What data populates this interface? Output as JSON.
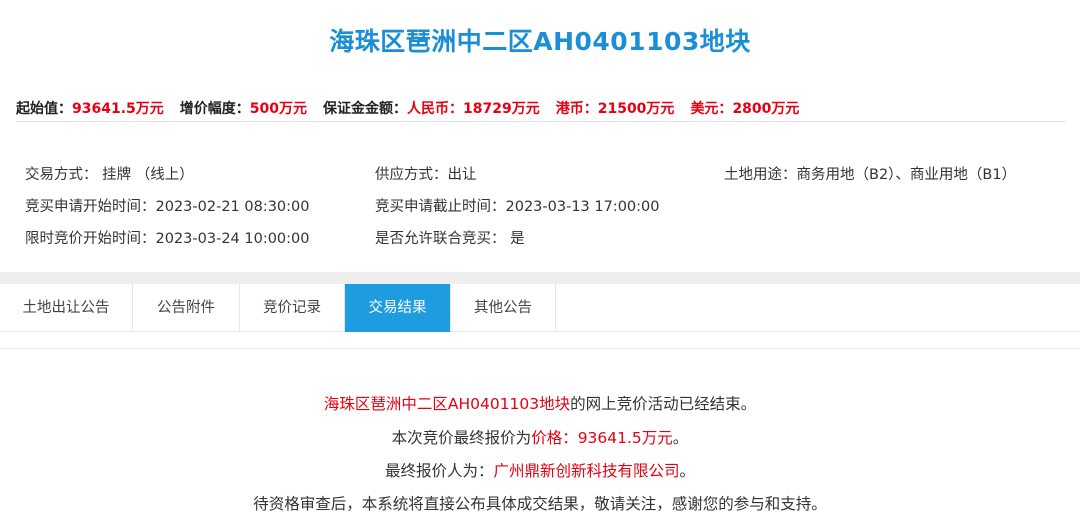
{
  "title": "海珠区琶洲中二区AH0401103地块",
  "price_row": {
    "start_label": "起始值：",
    "start_value": "93641.5万元",
    "increment_label": "增价幅度：",
    "increment_value": "500万元",
    "deposit_label": "保证金金额：",
    "rmb_label": "人民币：",
    "rmb_value": "18729万元",
    "hkd_label": "港币：",
    "hkd_value": "21500万元",
    "usd_label": "美元：",
    "usd_value": "2800万元"
  },
  "info": {
    "trade_method": "交易方式：  挂牌  （线上）",
    "supply_method": "供应方式：出让",
    "land_use": "土地用途：商务用地（B2）、商业用地（B1）",
    "apply_start": "竞买申请开始时间：2023-02-21 08:30:00",
    "apply_end": "竞买申请截止时间：2023-03-13 17:00:00",
    "bid_start": "限时竞价开始时间：2023-03-24 10:00:00",
    "joint_bid": "是否允许联合竞买：  是"
  },
  "tabs": [
    {
      "label": "土地出让公告",
      "active": false
    },
    {
      "label": "公告附件",
      "active": false
    },
    {
      "label": "竞价记录",
      "active": false
    },
    {
      "label": "交易结果",
      "active": true
    },
    {
      "label": "其他公告",
      "active": false
    }
  ],
  "result": {
    "line1_red": "海珠区琶洲中二区AH0401103地块",
    "line1_rest": "的网上竞价活动已经结束。",
    "line2_prefix": "本次竞价最终报价为",
    "line2_red": "价格：93641.5万元",
    "line2_suffix": "。",
    "line3_prefix": "最终报价人为：",
    "line3_red": "广州鼎新创新科技有限公司",
    "line3_suffix": "。",
    "line4": "待资格审查后，本系统将直接公布具体成交结果，敬请关注，感谢您的参与和支持。"
  },
  "colors": {
    "title": "#1a8fd6",
    "highlight_red": "#e60012",
    "active_tab": "#1f9be0"
  }
}
